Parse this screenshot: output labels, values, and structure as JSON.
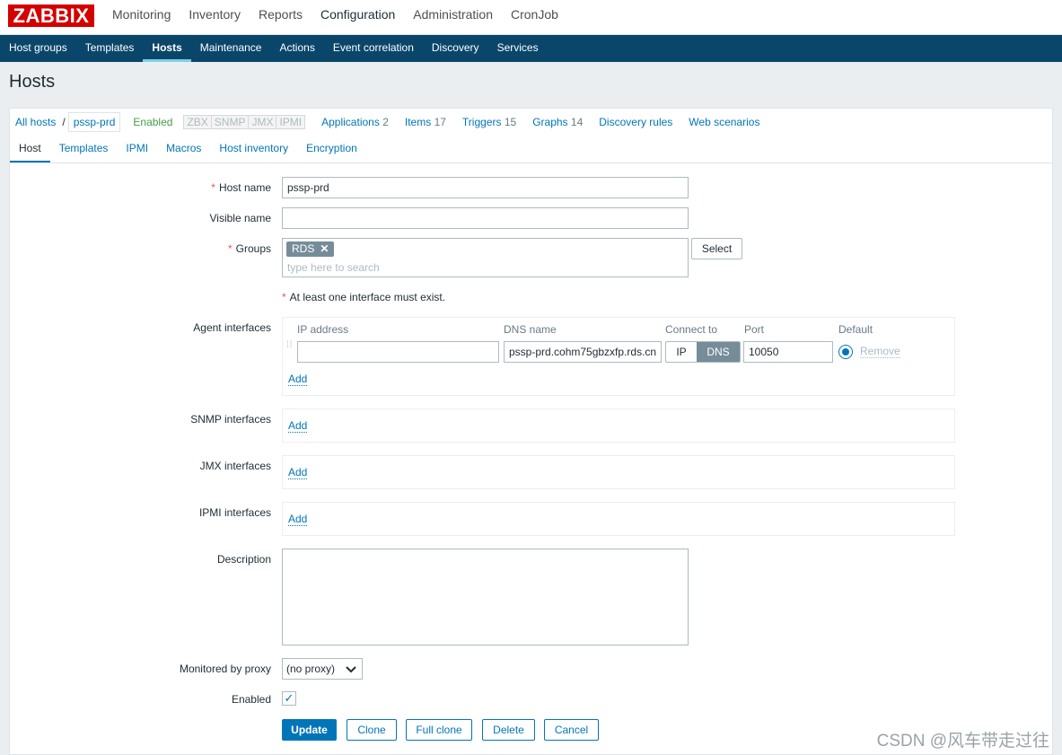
{
  "logo": "ZABBIX",
  "top_menu": [
    "Monitoring",
    "Inventory",
    "Reports",
    "Configuration",
    "Administration",
    "CronJob"
  ],
  "sub_menu": [
    "Host groups",
    "Templates",
    "Hosts",
    "Maintenance",
    "Actions",
    "Event correlation",
    "Discovery",
    "Services"
  ],
  "page_title": "Hosts",
  "host_nav": {
    "all_hosts": "All hosts",
    "separator": "/",
    "current": "pssp-prd",
    "status": "Enabled",
    "availability": [
      "ZBX",
      "SNMP",
      "JMX",
      "IPMI"
    ],
    "links": [
      {
        "label": "Applications",
        "count": "2"
      },
      {
        "label": "Items",
        "count": "17"
      },
      {
        "label": "Triggers",
        "count": "15"
      },
      {
        "label": "Graphs",
        "count": "14"
      },
      {
        "label": "Discovery rules",
        "count": ""
      },
      {
        "label": "Web scenarios",
        "count": ""
      }
    ]
  },
  "tabs": [
    "Host",
    "Templates",
    "IPMI",
    "Macros",
    "Host inventory",
    "Encryption"
  ],
  "form": {
    "required_mark": "*",
    "host_name_label": "Host name",
    "host_name_value": "pssp-prd",
    "visible_name_label": "Visible name",
    "visible_name_value": "",
    "groups_label": "Groups",
    "group_tag": "RDS",
    "group_tag_remove": "✕",
    "groups_placeholder": "type here to search",
    "select_button": "Select",
    "interface_note": "At least one interface must exist.",
    "agent_label": "Agent interfaces",
    "col_ip": "IP address",
    "col_dns": "DNS name",
    "col_connect": "Connect to",
    "col_port": "Port",
    "col_default": "Default",
    "ip_value": "",
    "dns_value": "pssp-prd.cohm75gbzxfp.rds.cn",
    "connect_ip": "IP",
    "connect_dns": "DNS",
    "port_value": "10050",
    "remove_link": "Remove",
    "add_link": "Add",
    "snmp_label": "SNMP interfaces",
    "jmx_label": "JMX interfaces",
    "ipmi_label": "IPMI interfaces",
    "description_label": "Description",
    "description_value": "",
    "proxy_label": "Monitored by proxy",
    "proxy_value": "(no proxy)",
    "enabled_label": "Enabled",
    "enabled_checked": "✓"
  },
  "buttons": {
    "update": "Update",
    "clone": "Clone",
    "full_clone": "Full clone",
    "delete": "Delete",
    "cancel": "Cancel"
  },
  "watermark": "CSDN @风车带走过往",
  "colors": {
    "nav_bg": "#0a466a",
    "link": "#0275b8",
    "logo": "#d40000",
    "enabled": "#429e47"
  }
}
